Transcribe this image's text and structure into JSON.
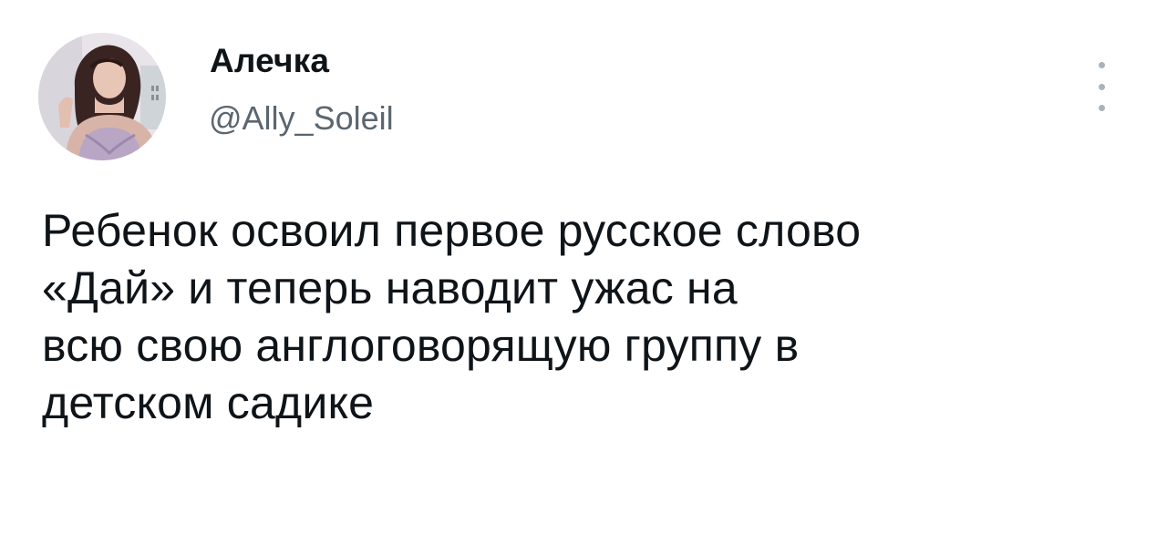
{
  "tweet": {
    "author": {
      "display_name": "Алечка",
      "handle": "@Ally_Soleil"
    },
    "menu_icon": "more-vertical-icon",
    "text_lines": [
      "Ребенок освоил первое русское слово",
      "«Дай» и теперь наводит ужас на",
      "всю свою англоговорящую группу в",
      "детском садике"
    ]
  },
  "colors": {
    "text": "#0f1419",
    "secondary": "#5b6670",
    "icon": "#aab3bb"
  }
}
